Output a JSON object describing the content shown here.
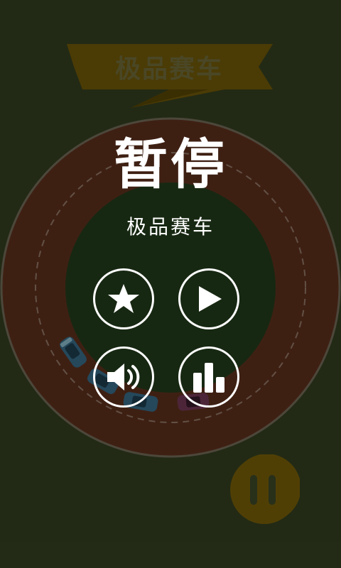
{
  "game": {
    "title": "极品赛车",
    "pause_title": "暂停",
    "subtitle": "极品赛车"
  },
  "buttons": {
    "rate": {
      "icon": "star-icon"
    },
    "resume": {
      "icon": "play-icon"
    },
    "sound": {
      "icon": "speaker-icon"
    },
    "leaderboard": {
      "icon": "bar-chart-icon"
    },
    "pause": {
      "icon": "pause-icon"
    }
  },
  "colors": {
    "background": "#283019",
    "track": "#4a2416",
    "infield": "#1a2e15",
    "banner": "#4b3b05",
    "pause_button": "#503f05",
    "white": "#ffffff"
  }
}
